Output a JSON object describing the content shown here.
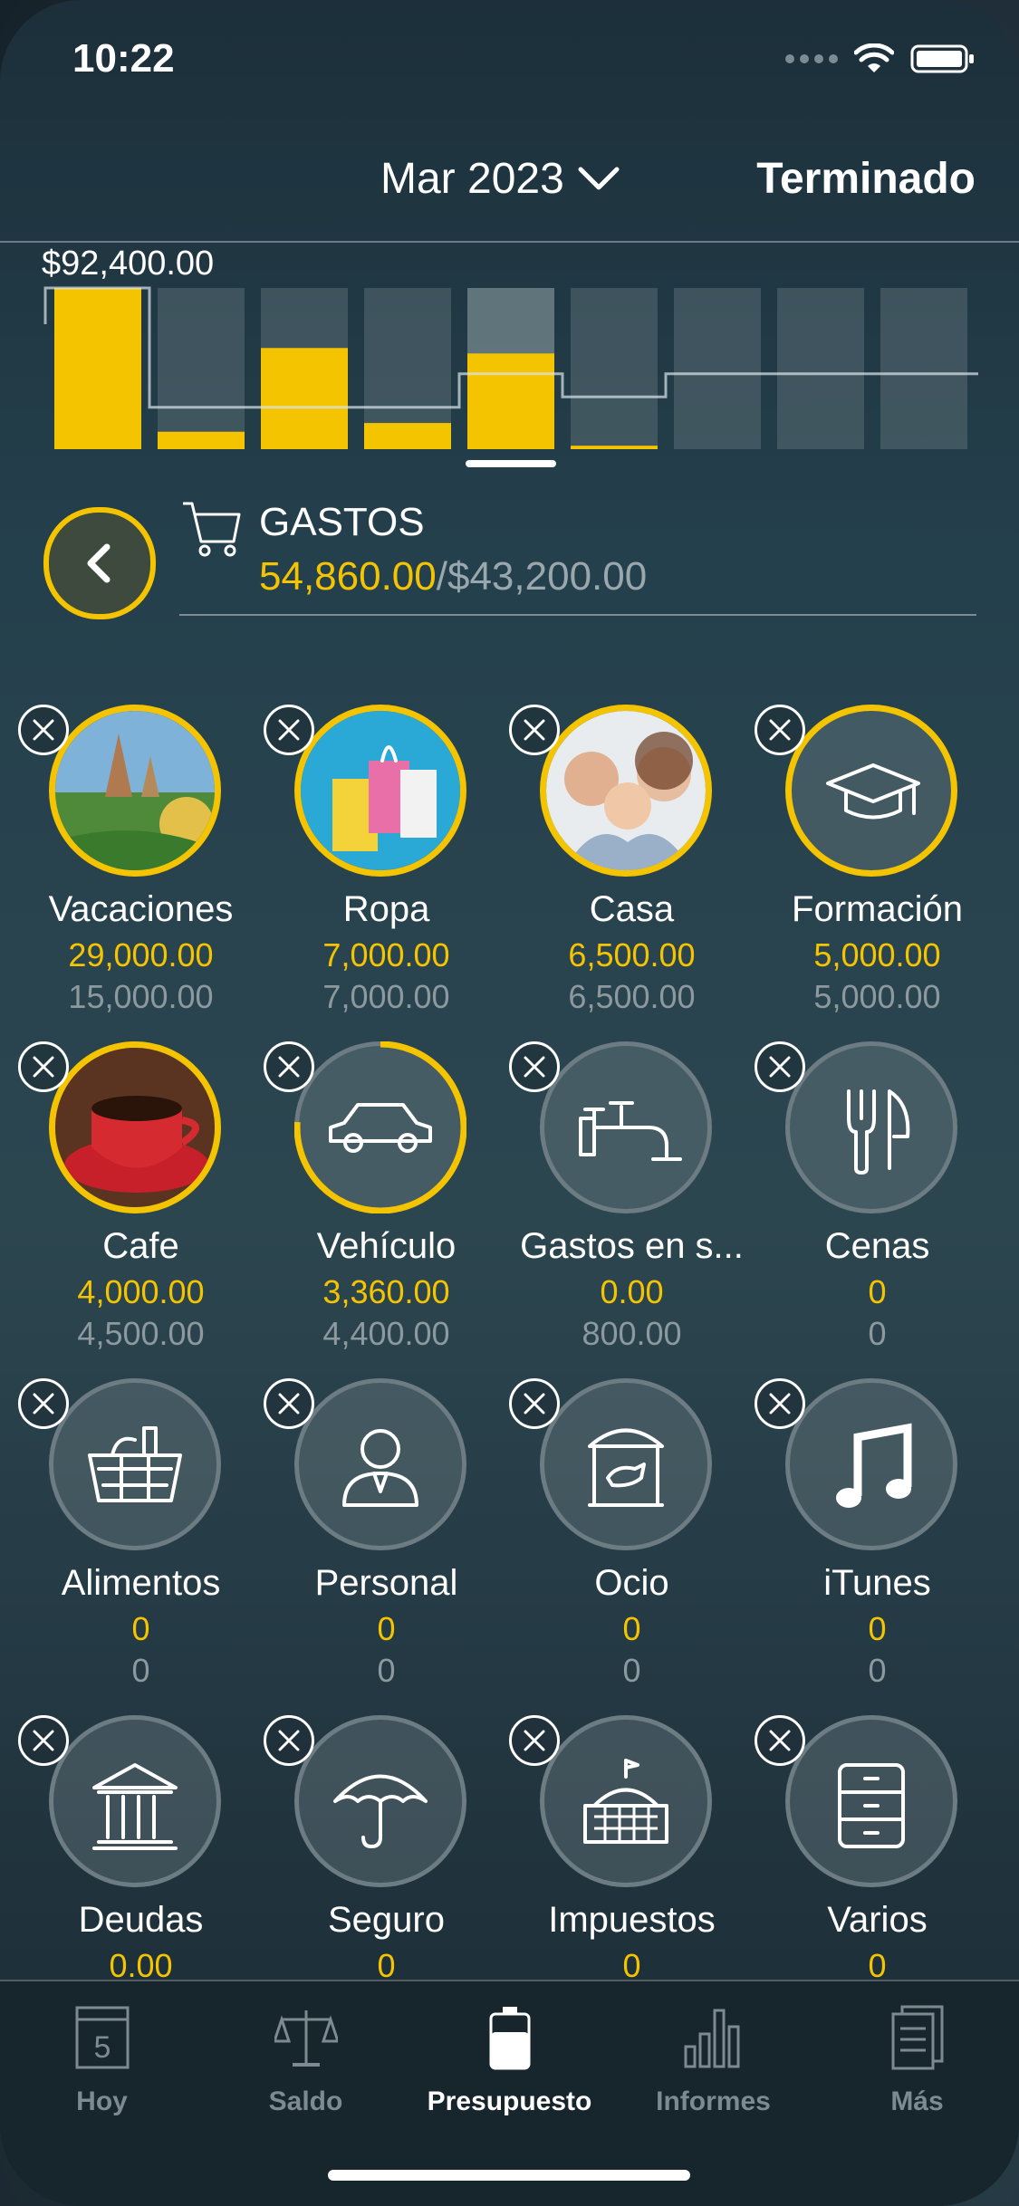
{
  "status_bar": {
    "time": "10:22"
  },
  "header": {
    "month": "Mar 2023",
    "done_label": "Terminado"
  },
  "chart_data": {
    "type": "bar",
    "max_label": "$92,400.00",
    "bar_count": 9,
    "spent": [
      92400,
      10000,
      58000,
      15000,
      54860,
      2000,
      0,
      0,
      0
    ],
    "budget": [
      92400,
      24000,
      24000,
      24000,
      43200,
      30000,
      43200,
      43200,
      43200
    ],
    "ymax": 92400,
    "selected_index": 4
  },
  "gastos": {
    "title": "GASTOS",
    "spent": "54,860.00",
    "separator": "/",
    "budget": "$43,200.00"
  },
  "categories": [
    {
      "name": "Vacaciones",
      "spent": "29,000.00",
      "budget": "15,000.00",
      "icon": "vacation-photo-icon",
      "active": true,
      "progress": 1
    },
    {
      "name": "Ropa",
      "spent": "7,000.00",
      "budget": "7,000.00",
      "icon": "shopping-bags-photo-icon",
      "active": true,
      "progress": 1
    },
    {
      "name": "Casa",
      "spent": "6,500.00",
      "budget": "6,500.00",
      "icon": "family-photo-icon",
      "active": true,
      "progress": 1
    },
    {
      "name": "Formación",
      "spent": "5,000.00",
      "budget": "5,000.00",
      "icon": "graduation-cap-icon",
      "active": true,
      "progress": 1
    },
    {
      "name": "Cafe",
      "spent": "4,000.00",
      "budget": "4,500.00",
      "icon": "coffee-cup-photo-icon",
      "active": true,
      "progress": 0.89
    },
    {
      "name": "Vehículo",
      "spent": "3,360.00",
      "budget": "4,400.00",
      "icon": "car-icon",
      "active": false,
      "progress": 0.76
    },
    {
      "name": "Gastos en s...",
      "spent": "0.00",
      "budget": "800.00",
      "icon": "faucet-icon",
      "active": false,
      "progress": 0
    },
    {
      "name": "Cenas",
      "spent": "0",
      "budget": "0",
      "icon": "fork-knife-icon",
      "active": false,
      "progress": 0
    },
    {
      "name": "Alimentos",
      "spent": "0",
      "budget": "0",
      "icon": "grocery-basket-icon",
      "active": false,
      "progress": 0
    },
    {
      "name": "Personal",
      "spent": "0",
      "budget": "0",
      "icon": "person-icon",
      "active": false,
      "progress": 0
    },
    {
      "name": "Ocio",
      "spent": "0",
      "budget": "0",
      "icon": "carousel-icon",
      "active": false,
      "progress": 0
    },
    {
      "name": "iTunes",
      "spent": "0",
      "budget": "0",
      "icon": "music-note-icon",
      "active": false,
      "progress": 0
    },
    {
      "name": "Deudas",
      "spent": "0.00",
      "budget": "",
      "icon": "bank-icon",
      "active": false,
      "progress": 0
    },
    {
      "name": "Seguro",
      "spent": "0",
      "budget": "",
      "icon": "umbrella-icon",
      "active": false,
      "progress": 0
    },
    {
      "name": "Impuestos",
      "spent": "0",
      "budget": "",
      "icon": "government-building-icon",
      "active": false,
      "progress": 0
    },
    {
      "name": "Varios",
      "spent": "0",
      "budget": "",
      "icon": "cabinet-drawers-icon",
      "active": false,
      "progress": 0
    }
  ],
  "tabs": [
    {
      "label": "Hoy",
      "icon": "calendar-icon",
      "calendar_day": "5",
      "active": false
    },
    {
      "label": "Saldo",
      "icon": "scales-icon",
      "active": false
    },
    {
      "label": "Presupuesto",
      "icon": "battery-icon",
      "active": true
    },
    {
      "label": "Informes",
      "icon": "bar-chart-icon",
      "active": false
    },
    {
      "label": "Más",
      "icon": "document-icon",
      "active": false
    }
  ],
  "colors": {
    "accent": "#f5c400",
    "muted": "#8c999f",
    "background": "#24404c"
  }
}
